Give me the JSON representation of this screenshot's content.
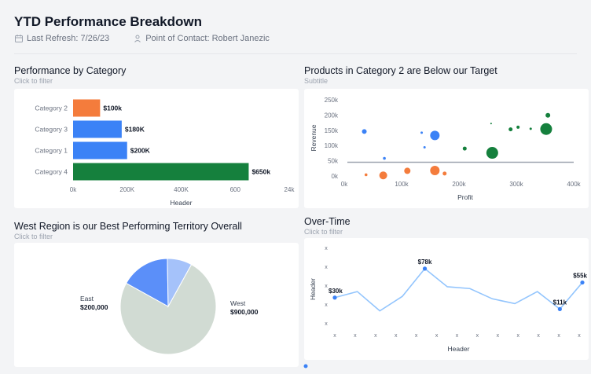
{
  "header": {
    "title": "YTD Performance Breakdown",
    "refresh": "Last Refresh: 7/26/23",
    "contact": "Point of Contact: Robert Janezic"
  },
  "panels": {
    "category": {
      "title": "Performance by Category",
      "subtitle": "Click to filter"
    },
    "products": {
      "title": "Products in Category 2 are Below our Target",
      "subtitle": "Subtitle"
    },
    "region": {
      "title": "West Region is our Best Performing Territory Overall",
      "subtitle": "Click to filter"
    },
    "overtime": {
      "title": "Over-Time",
      "subtitle": "Click to filter"
    }
  },
  "chart_data": [
    {
      "type": "bar",
      "orientation": "horizontal",
      "categories": [
        "Category 2",
        "Category 3",
        "Category 1",
        "Category 4"
      ],
      "values": [
        100,
        180,
        200,
        650
      ],
      "labels": [
        "$100k",
        "$180K",
        "$200K",
        "$650k"
      ],
      "colors": [
        "#f47c3c",
        "#3b82f6",
        "#3b82f6",
        "#15803d"
      ],
      "xticks": [
        "0k",
        "200K",
        "400K",
        "600",
        "24k"
      ],
      "xlabel": "Header",
      "xlim": [
        0,
        800
      ]
    },
    {
      "type": "scatter",
      "ylabel": "Revenue",
      "xlabel": "Profit",
      "xticks": [
        "0k",
        "100k",
        "200k",
        "300k",
        "400k"
      ],
      "yticks": [
        "0k",
        "50k",
        "100k",
        "150k",
        "200k",
        "250k"
      ],
      "xlim": [
        0,
        400
      ],
      "ylim": [
        0,
        250
      ],
      "target": 45,
      "points": [
        {
          "x": 35,
          "y": 146,
          "r": 3,
          "color": "#3b82f6"
        },
        {
          "x": 70,
          "y": 58,
          "r": 1.8,
          "color": "#3b82f6"
        },
        {
          "x": 135,
          "y": 142,
          "r": 1.5,
          "color": "#3b82f6"
        },
        {
          "x": 140,
          "y": 94,
          "r": 1.5,
          "color": "#3b82f6"
        },
        {
          "x": 158,
          "y": 133,
          "r": 6,
          "color": "#3b82f6"
        },
        {
          "x": 38,
          "y": 4,
          "r": 1.8,
          "color": "#f47c3c"
        },
        {
          "x": 68,
          "y": 2,
          "r": 5,
          "color": "#f47c3c"
        },
        {
          "x": 110,
          "y": 17,
          "r": 4,
          "color": "#f47c3c"
        },
        {
          "x": 158,
          "y": 18,
          "r": 6,
          "color": "#f47c3c"
        },
        {
          "x": 175,
          "y": 8,
          "r": 2.5,
          "color": "#f47c3c"
        },
        {
          "x": 210,
          "y": 90,
          "r": 2.5,
          "color": "#15803d"
        },
        {
          "x": 258,
          "y": 76,
          "r": 7.5,
          "color": "#15803d"
        },
        {
          "x": 256,
          "y": 172,
          "r": 1,
          "color": "#15803d"
        },
        {
          "x": 290,
          "y": 153,
          "r": 2.5,
          "color": "#15803d"
        },
        {
          "x": 303,
          "y": 160,
          "r": 2,
          "color": "#15803d"
        },
        {
          "x": 325,
          "y": 155,
          "r": 1.5,
          "color": "#15803d"
        },
        {
          "x": 355,
          "y": 199,
          "r": 3,
          "color": "#15803d"
        },
        {
          "x": 352,
          "y": 154,
          "r": 7.5,
          "color": "#15803d"
        }
      ]
    },
    {
      "type": "pie",
      "slices": [
        {
          "name": "West",
          "label": "$900,000",
          "value": 900000,
          "color": "#d1dbd3"
        },
        {
          "name": "East",
          "label": "$200,000",
          "value": 200000,
          "color": "#5b8ff9"
        },
        {
          "name": "",
          "label": "",
          "value": 100000,
          "color": "#a5c2fa"
        }
      ]
    },
    {
      "type": "line",
      "xlabel": "Header",
      "ylabel": "Header",
      "xticks": [
        "x",
        "x",
        "x",
        "x",
        "x",
        "x",
        "x",
        "x",
        "x",
        "x",
        "x",
        "x",
        "x"
      ],
      "yticks": [
        "x",
        "x",
        "x",
        "x",
        "x"
      ],
      "values": [
        30,
        40,
        8,
        32,
        78,
        48,
        45,
        28,
        20,
        40,
        11,
        55
      ],
      "ylim": [
        -25,
        100
      ],
      "annotations": [
        {
          "index": 0,
          "label": "$30k"
        },
        {
          "index": 4,
          "label": "$78k"
        },
        {
          "index": 10,
          "label": "$11k"
        },
        {
          "index": 11,
          "label": "$55k"
        }
      ],
      "color": "#93c5fd",
      "marker_color": "#3b82f6"
    }
  ]
}
